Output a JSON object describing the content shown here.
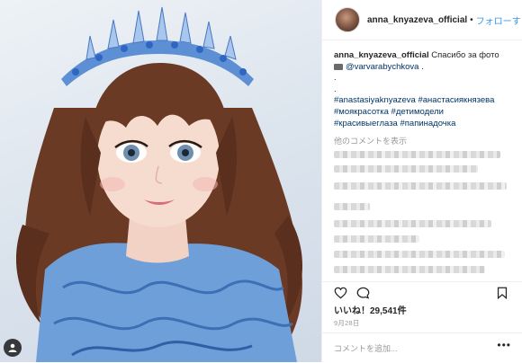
{
  "post": {
    "username": "anna_knyazeva_official",
    "follow_label": "フォローす",
    "caption_text": "Спасибо за фото",
    "caption_mention": "@varvarabychkova",
    "caption_dots": [
      ".",
      " ."
    ],
    "hashtags_lines": [
      "#anastasiyaknyazeva #анастасиякнязева",
      "#моякрасотка #детимодели",
      "#красивыеглаза #папинадочка"
    ],
    "more_comments_label": "他のコメントを表示",
    "likes_label": "いいね！29,541件",
    "date_label": "9月28日",
    "comment_placeholder": "コメントを追加...",
    "more_options": "•••"
  },
  "icons": [
    "tag-person-icon",
    "heart-icon",
    "comment-icon",
    "bookmark-icon",
    "camera-icon"
  ],
  "colors": {
    "link": "#3897f0",
    "hashtag": "#003569",
    "muted": "#999999",
    "text": "#262626"
  }
}
